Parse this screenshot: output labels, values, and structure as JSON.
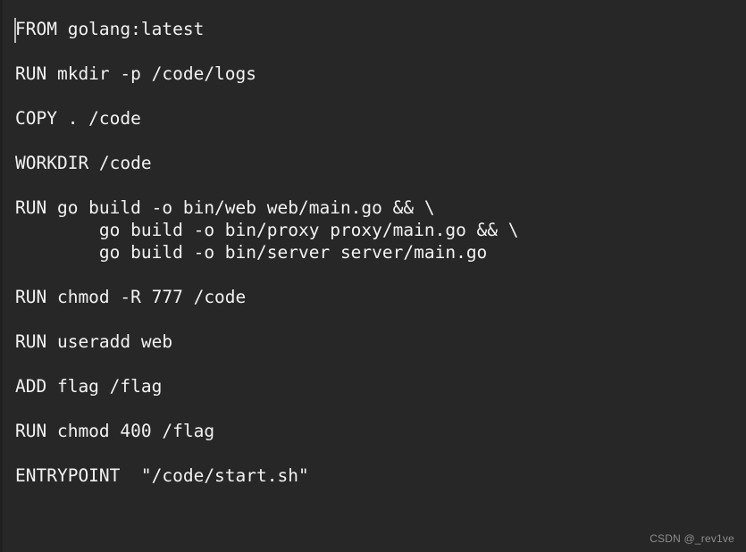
{
  "editor": {
    "kind": "plain-text-code-view",
    "language_label": "dockerfile",
    "background_color": "#272727",
    "gutter_color": "#1f1f1f",
    "text_color": "#f2f2f2",
    "caret_color": "#b9b9b9",
    "caret": {
      "visible": true,
      "line": 1,
      "column": 1
    },
    "font_size_px": 19.5,
    "line_height_px": 25,
    "lines": [
      "FROM golang:latest",
      "",
      "RUN mkdir -p /code/logs",
      "",
      "COPY . /code",
      "",
      "WORKDIR /code",
      "",
      "RUN go build -o bin/web web/main.go && \\",
      "        go build -o bin/proxy proxy/main.go && \\",
      "        go build -o bin/server server/main.go",
      "",
      "RUN chmod -R 777 /code",
      "",
      "RUN useradd web",
      "",
      "ADD flag /flag",
      "",
      "RUN chmod 400 /flag",
      "",
      "ENTRYPOINT  \"/code/start.sh\""
    ],
    "instructions": [
      {
        "directive": "FROM",
        "arguments": "golang:latest"
      },
      {
        "directive": "RUN",
        "arguments": "mkdir -p /code/logs"
      },
      {
        "directive": "COPY",
        "arguments": ". /code"
      },
      {
        "directive": "WORKDIR",
        "arguments": "/code"
      },
      {
        "directive": "RUN",
        "arguments": "go build -o bin/web web/main.go && \\ go build -o bin/proxy proxy/main.go && \\ go build -o bin/server server/main.go"
      },
      {
        "directive": "RUN",
        "arguments": "chmod -R 777 /code"
      },
      {
        "directive": "RUN",
        "arguments": "useradd web"
      },
      {
        "directive": "ADD",
        "arguments": "flag /flag"
      },
      {
        "directive": "RUN",
        "arguments": "chmod 400 /flag"
      },
      {
        "directive": "ENTRYPOINT",
        "arguments": "\"/code/start.sh\""
      }
    ]
  },
  "watermark": {
    "text": "CSDN @_rev1ve",
    "color": "#8d8d8d"
  }
}
